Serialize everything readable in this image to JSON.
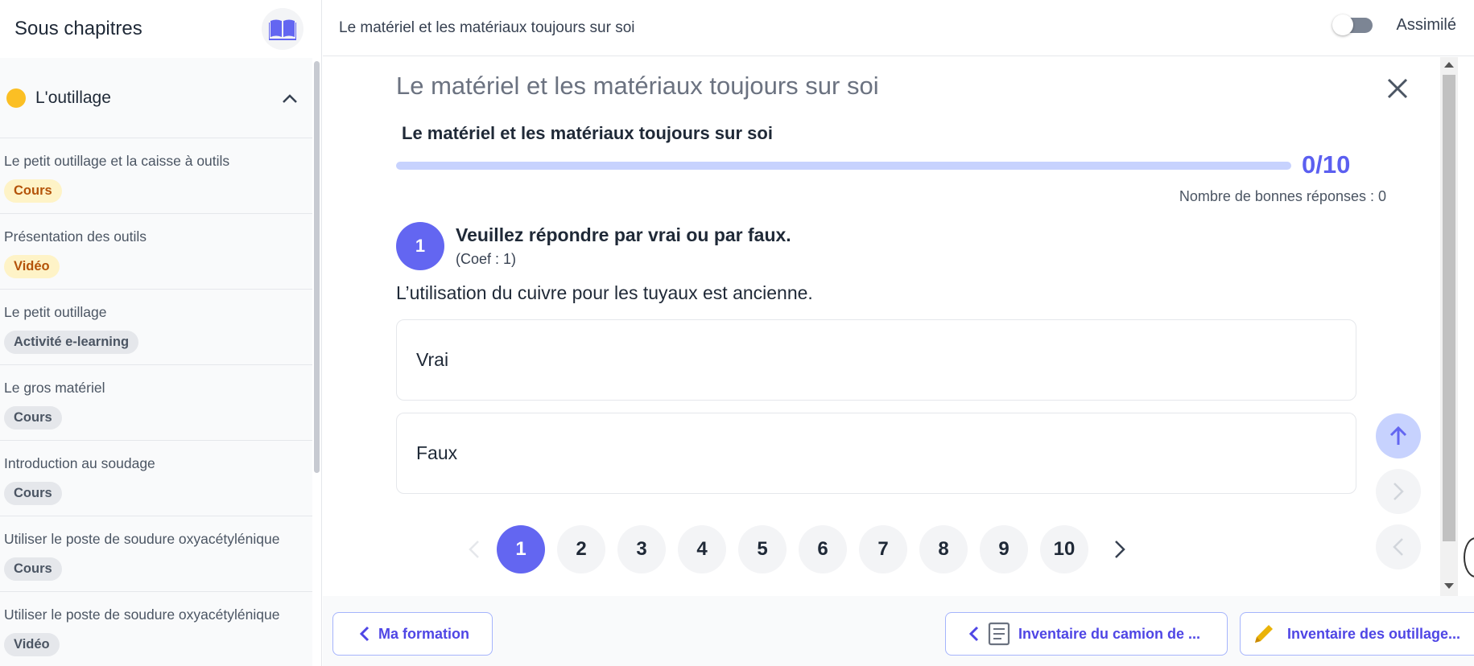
{
  "sidebar": {
    "title": "Sous chapitres",
    "chapter": {
      "label": "L'outillage",
      "dot_color": "#fbbf24"
    },
    "items": [
      {
        "title": "Le petit outillage et la caisse à outils",
        "badge": "Cours"
      },
      {
        "title": "Présentation des outils",
        "badge": "Vidéo"
      },
      {
        "title": "Le petit outillage",
        "badge": "Activité e-learning"
      },
      {
        "title": "Le gros matériel",
        "badge": "Cours"
      },
      {
        "title": "Introduction au soudage",
        "badge": "Cours"
      },
      {
        "title": "Utiliser le poste de soudure oxyacétylénique",
        "badge": "Cours"
      },
      {
        "title": "Utiliser le poste de soudure oxyacétylénique",
        "badge": "Vidéo"
      }
    ]
  },
  "topbar": {
    "title": "Le matériel et les matériaux toujours sur soi",
    "toggle_label": "Assimilé",
    "toggle_on": false
  },
  "quiz": {
    "title": "Le matériel et les matériaux toujours sur soi",
    "subtitle": "Le matériel et les matériaux toujours sur soi",
    "score": "0/10",
    "progress_fraction": 0,
    "good_answers": "Nombre de bonnes réponses : 0",
    "question": {
      "number": "1",
      "title": "Veuillez répondre par vrai ou par faux.",
      "coef": "(Coef : 1)",
      "text": "L’utilisation du cuivre pour les tuyaux est ancienne.",
      "answers": [
        "Vrai",
        "Faux"
      ]
    },
    "pages": [
      "1",
      "2",
      "3",
      "4",
      "5",
      "6",
      "7",
      "8",
      "9",
      "10"
    ],
    "active_page": "1"
  },
  "bottom": {
    "back_label": "Ma formation",
    "prev_label": "Inventaire du camion de ...",
    "next_label": "Inventaire des outillage..."
  },
  "colors": {
    "accent": "#6366f1",
    "progress_track": "#c7d2fe",
    "badge_yellow_bg": "#fef3c7",
    "badge_yellow_text": "#b45309",
    "next_icon": "#eab308"
  },
  "icons": [
    "book-icon",
    "chevron-up-icon",
    "close-icon",
    "arrow-up-icon",
    "chevron-right-icon",
    "chevron-left-icon",
    "document-icon",
    "pencil-icon"
  ]
}
